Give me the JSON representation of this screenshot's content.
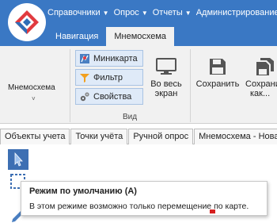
{
  "menu": [
    {
      "label": "Справочники"
    },
    {
      "label": "Опрос"
    },
    {
      "label": "Отчеты"
    },
    {
      "label": "Администрирование"
    }
  ],
  "tabs": [
    {
      "label": "Навигация"
    },
    {
      "label": "Мнемосхема"
    }
  ],
  "ribbon": {
    "mnemo_label": "Мнемосхема",
    "small_buttons": [
      {
        "label": "Миникарта"
      },
      {
        "label": "Фильтр"
      },
      {
        "label": "Свойства"
      }
    ],
    "group_label": "Вид",
    "full_screen_line1": "Во весь",
    "full_screen_line2": "экран",
    "save_label": "Сохранить",
    "save_as_line1": "Сохрани",
    "save_as_line2": "как..."
  },
  "doc_tabs": [
    {
      "label": "Объекты учета"
    },
    {
      "label": "Точки учёта"
    },
    {
      "label": "Ручной опрос"
    },
    {
      "label": "Мнемосхема - Нова"
    }
  ],
  "tooltip": {
    "title": "Режим по умолчанию (A)",
    "body": "В этом режиме возможно только перемещение по карте."
  },
  "colors": {
    "header": "#3a78c4",
    "ribbon": "#f1f1f1",
    "selected_tool": "#3d6fb3",
    "logo_red": "#e13a3f",
    "logo_blue": "#2f6db7"
  },
  "icons": {
    "minimap": "minimap-icon",
    "filter": "filter-icon",
    "properties": "gears-icon",
    "full_screen": "monitor-icon",
    "save": "floppy-icon",
    "save_as": "floppy-stack-icon",
    "default_mode": "cursor-arrow-icon"
  }
}
